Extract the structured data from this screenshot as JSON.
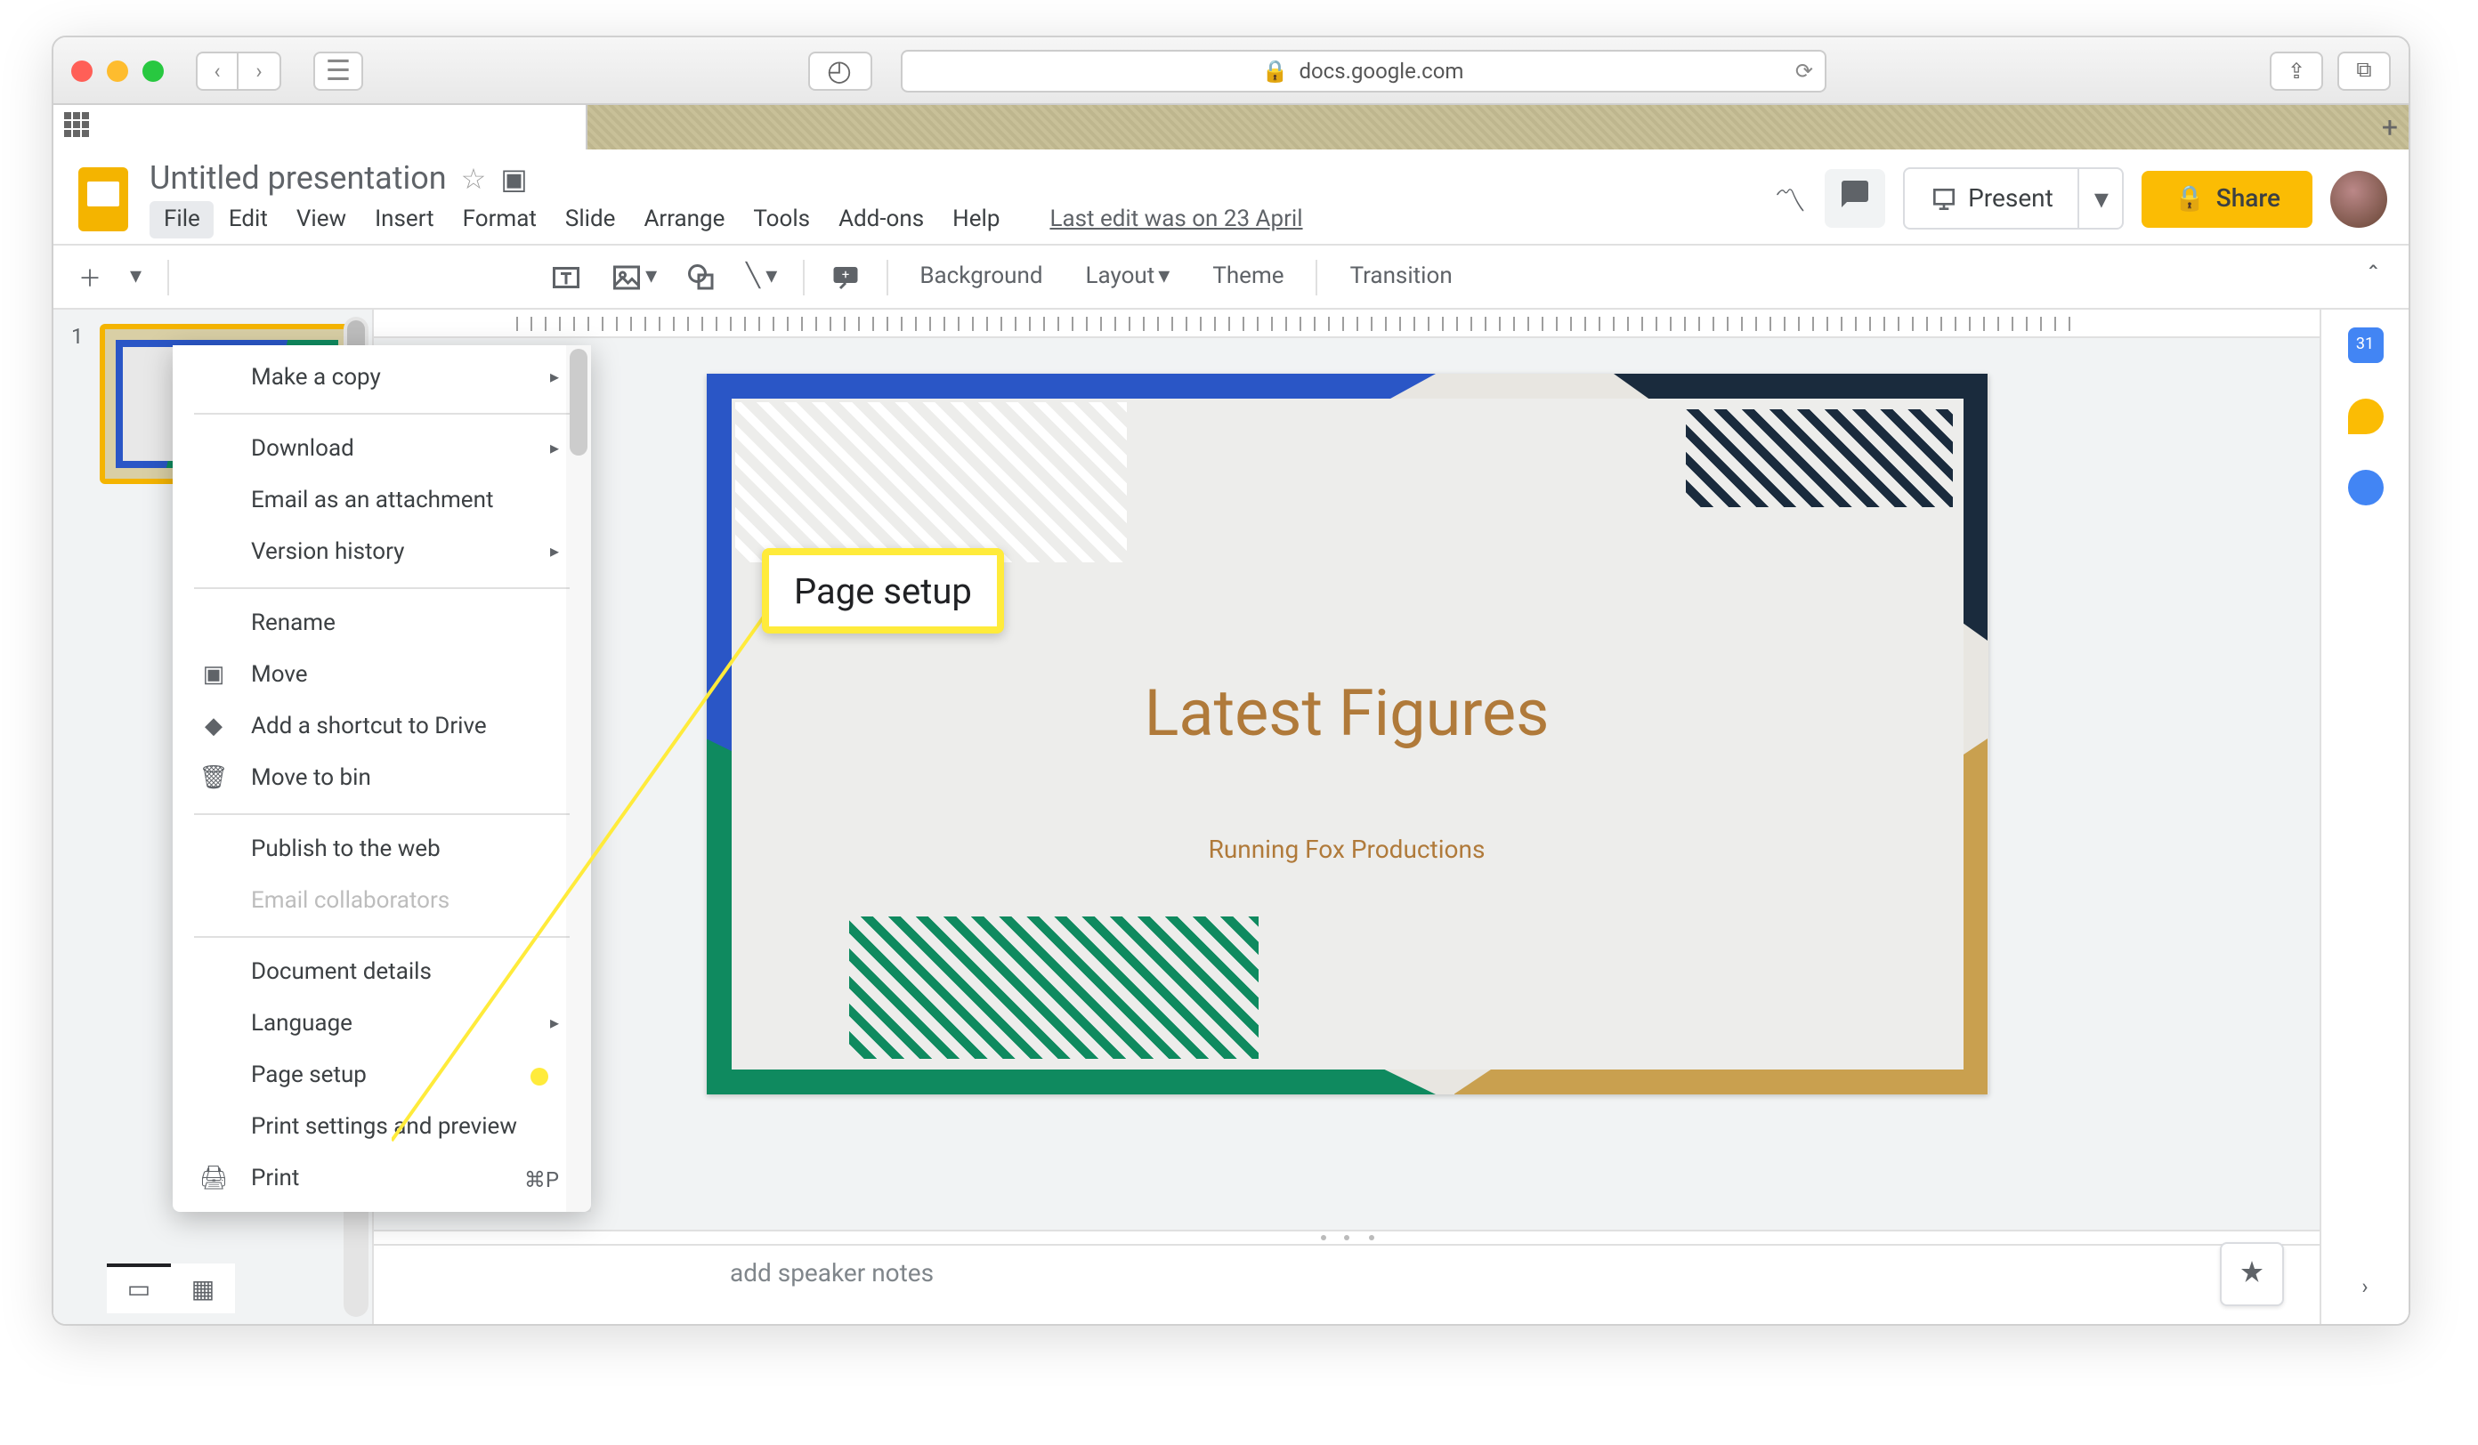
{
  "browser": {
    "url_host": "docs.google.com"
  },
  "doc": {
    "title": "Untitled presentation",
    "last_edit": "Last edit was on 23 April"
  },
  "menubar": [
    "File",
    "Edit",
    "View",
    "Insert",
    "Format",
    "Slide",
    "Arrange",
    "Tools",
    "Add-ons",
    "Help"
  ],
  "toolbar": {
    "background": "Background",
    "layout": "Layout",
    "theme": "Theme",
    "transition": "Transition"
  },
  "present_label": "Present",
  "share_label": "Share",
  "filmstrip": {
    "slide1_num": "1"
  },
  "slide": {
    "title": "Latest Figures",
    "subtitle": "Running Fox Productions"
  },
  "notes_placeholder": "add speaker notes",
  "file_menu": {
    "make_copy": "Make a copy",
    "download": "Download",
    "email_attachment": "Email as an attachment",
    "version_history": "Version history",
    "rename": "Rename",
    "move": "Move",
    "add_shortcut": "Add a shortcut to Drive",
    "move_to_bin": "Move to bin",
    "publish": "Publish to the web",
    "email_collab": "Email collaborators",
    "doc_details": "Document details",
    "language": "Language",
    "page_setup": "Page setup",
    "print_settings": "Print settings and preview",
    "print": "Print",
    "print_shortcut": "⌘P"
  },
  "callout_label": "Page setup"
}
